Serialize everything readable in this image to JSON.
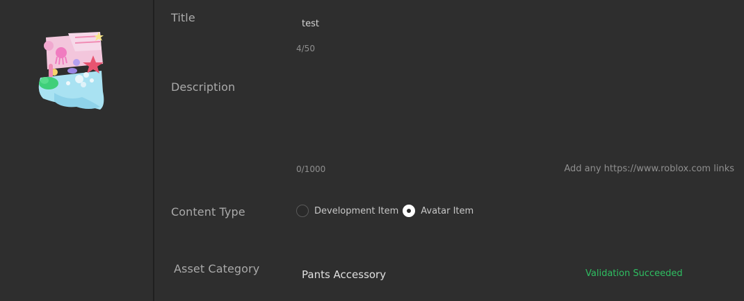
{
  "form": {
    "title_label": "Title",
    "title_value": "test",
    "title_counter": "4/50",
    "description_label": "Description",
    "description_value": "",
    "description_counter": "0/1000",
    "description_hint": "Add any https://www.roblox.com links",
    "content_type_label": "Content Type",
    "content_type_options": [
      {
        "label": "Development Item",
        "selected": false
      },
      {
        "label": "Avatar Item",
        "selected": true
      }
    ],
    "asset_category_label": "Asset Category",
    "asset_category_value": "Pants Accessory",
    "validation_status": "Validation Succeeded"
  },
  "preview": {
    "icon": "pants-accessory-thumbnail-icon"
  },
  "colors": {
    "background": "#2e2e2e",
    "divider": "#1f1f1f",
    "label": "#aaaaaa",
    "success": "#2fbf62"
  }
}
